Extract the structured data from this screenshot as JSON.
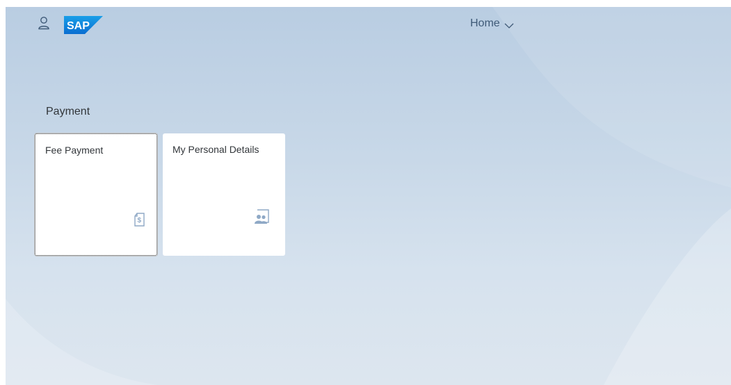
{
  "header": {
    "user_icon": "person-icon",
    "logo_text": "SAP",
    "nav_label": "Home",
    "nav_icon": "chevron-down-icon"
  },
  "groups": [
    {
      "title": "Payment",
      "tiles": [
        {
          "title": "Fee Payment",
          "icon": "document-dollar-icon",
          "focused": true
        },
        {
          "title": "My Personal Details",
          "icon": "employee-group-icon",
          "focused": false
        }
      ]
    }
  ],
  "colors": {
    "brand": "#0a6ed1",
    "icon": "#8fa9c6",
    "text": "#32363a",
    "header_text": "#3f5a78"
  }
}
